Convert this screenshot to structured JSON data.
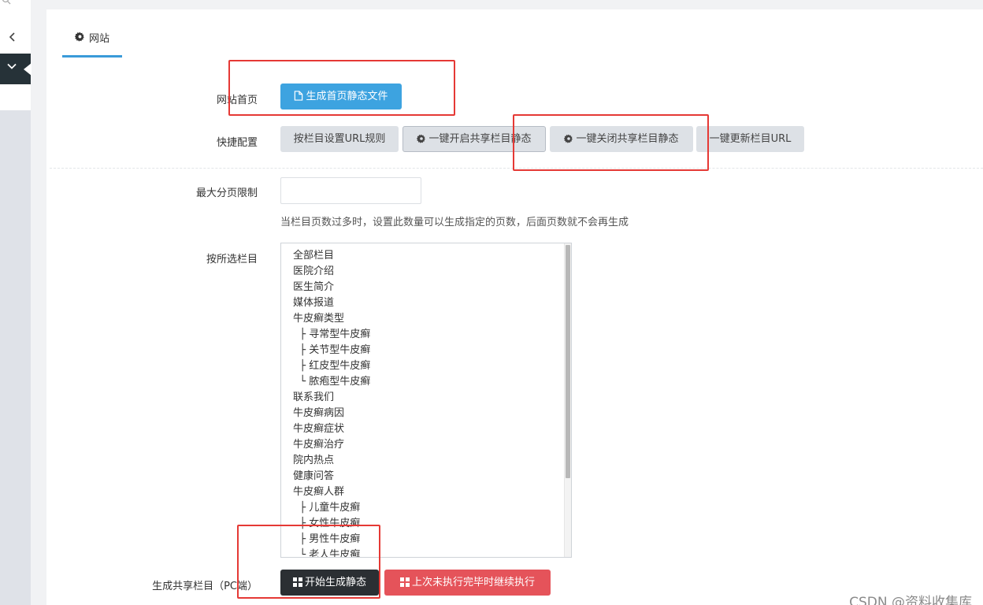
{
  "sidebar": {
    "search_icon": "search-icon",
    "back_icon": "chevron-left-icon",
    "active_icon": "chevron-down-icon"
  },
  "tab": {
    "label": "网站",
    "icon": "gear-icon"
  },
  "form": {
    "homepage": {
      "label": "网站首页",
      "button_label": "生成首页静态文件",
      "button_icon": "file-icon"
    },
    "quick_config": {
      "label": "快捷配置",
      "buttons": [
        {
          "label": "按栏目设置URL规则"
        },
        {
          "label": "一键开启共享栏目静态",
          "icon": "gear-icon"
        },
        {
          "label": "一键关闭共享栏目静态",
          "icon": "gear-icon"
        },
        {
          "label": "一键更新栏目URL"
        }
      ]
    },
    "max_pages": {
      "label": "最大分页限制",
      "value": "",
      "hint": "当栏目页数过多时，设置此数量可以生成指定的页数，后面页数就不会再生成"
    },
    "columns": {
      "label": "按所选栏目",
      "items": [
        "全部栏目",
        "医院介绍",
        "医生简介",
        "媒体报道",
        "牛皮癣类型",
        "  ├ 寻常型牛皮癣",
        "  ├ 关节型牛皮癣",
        "  ├ 红皮型牛皮癣",
        "  └ 脓疱型牛皮癣",
        "联系我们",
        "牛皮癣病因",
        "牛皮癣症状",
        "牛皮癣治疗",
        "院内热点",
        "健康问答",
        "牛皮癣人群",
        "  ├ 儿童牛皮癣",
        "  ├ 女性牛皮癣",
        "  ├ 男性牛皮癣",
        "  └ 老人牛皮癣"
      ]
    },
    "generate": {
      "label": "生成共享栏目（PC端）",
      "start_label": "开始生成静态",
      "resume_label": "上次未执行完毕时继续执行",
      "button_icon": "grid-icon"
    }
  },
  "colors": {
    "primary": "#3da3e0",
    "danger": "#e5535a",
    "dark": "#2b2f33",
    "annotation": "#e53935"
  },
  "watermark": "CSDN @资料收集库"
}
